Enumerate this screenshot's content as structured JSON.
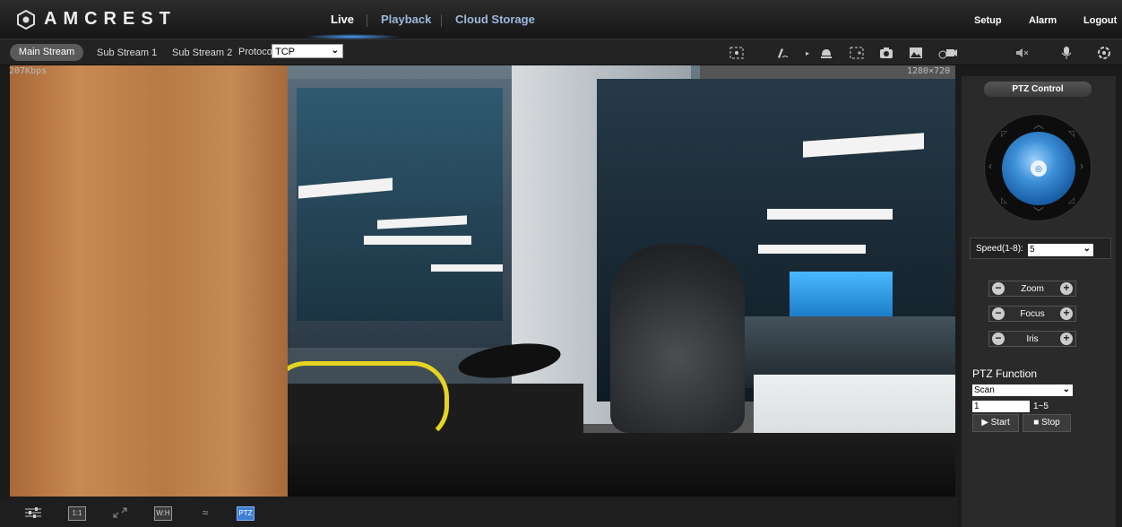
{
  "header": {
    "logo_text": "AMCREST",
    "nav": [
      "Live",
      "Playback",
      "Cloud Storage"
    ],
    "active_nav": "Live",
    "right_nav": [
      "Setup",
      "Alarm",
      "Logout"
    ]
  },
  "toolbar": {
    "streams": [
      "Main Stream",
      "Sub Stream 1",
      "Sub Stream 2"
    ],
    "active_stream": "Main Stream",
    "protocol_label": "Protocol",
    "protocol_value": "TCP",
    "icons": [
      "digital-zoom-icon",
      "draw-icon",
      "alarm-bell-icon",
      "region-zoom-icon",
      "snapshot-icon",
      "image-adjust-icon",
      "record-icon",
      "audio-mute-icon",
      "microphone-icon",
      "fisheye-icon"
    ]
  },
  "video": {
    "bitrate": "207Kbps",
    "resolution": "1280×720"
  },
  "bottombar": {
    "buttons": [
      {
        "icon": "adjust-icon",
        "label": ""
      },
      {
        "icon": "original-size-icon",
        "label": "1:1"
      },
      {
        "icon": "fullscreen-icon",
        "label": ""
      },
      {
        "icon": "aspect-ratio-icon",
        "label": "W:H"
      },
      {
        "icon": "fluency-icon",
        "label": ""
      },
      {
        "icon": "ptz-icon",
        "label": "PTZ"
      }
    ]
  },
  "ptz": {
    "title": "PTZ Control",
    "speed_label": "Speed(1-8):",
    "speed_value": "5",
    "controls": [
      "Zoom",
      "Focus",
      "Iris"
    ],
    "function_title": "PTZ Function",
    "function_value": "Scan",
    "function_input": "1",
    "function_range": "1~5",
    "start_label": "Start",
    "stop_label": "Stop"
  }
}
